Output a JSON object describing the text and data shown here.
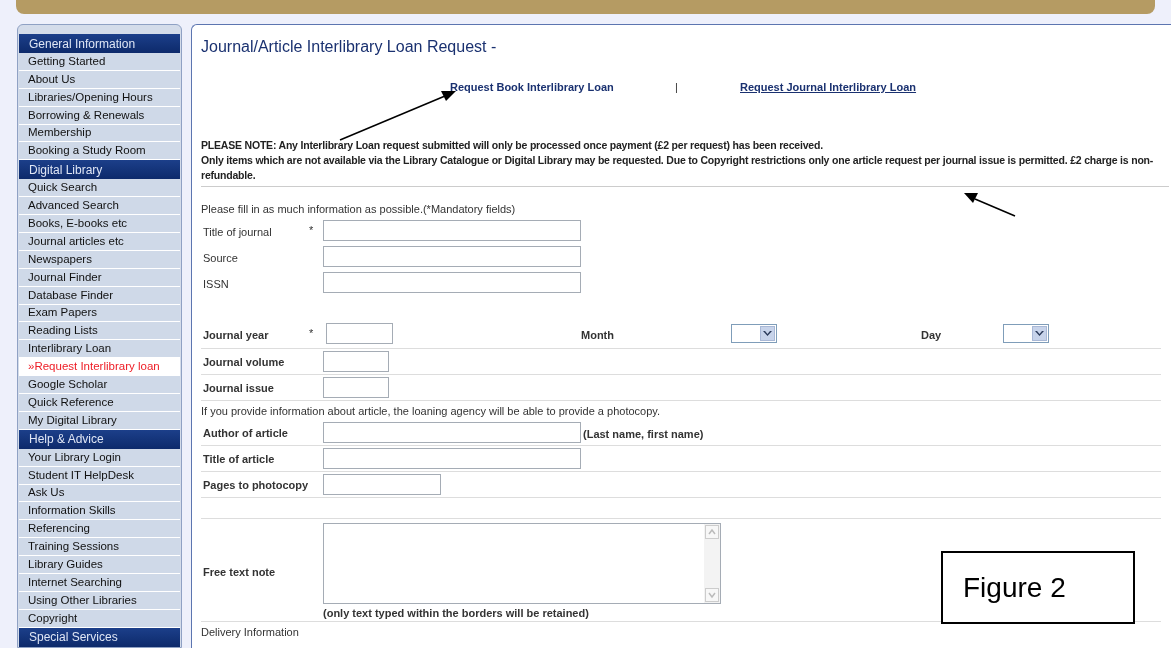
{
  "sidebar": {
    "sections": [
      {
        "heading": "General Information",
        "items": [
          {
            "label": "Getting Started",
            "selected": false
          },
          {
            "label": "About Us",
            "selected": false
          },
          {
            "label": "Libraries/Opening Hours",
            "selected": false
          },
          {
            "label": "Borrowing & Renewals",
            "selected": false
          },
          {
            "label": "Membership",
            "selected": false
          },
          {
            "label": "Booking a Study Room",
            "selected": false
          }
        ]
      },
      {
        "heading": "Digital Library",
        "items": [
          {
            "label": "Quick Search",
            "selected": false
          },
          {
            "label": "Advanced Search",
            "selected": false
          },
          {
            "label": "Books, E-books etc",
            "selected": false
          },
          {
            "label": "Journal articles etc",
            "selected": false
          },
          {
            "label": "Newspapers",
            "selected": false
          },
          {
            "label": "Journal Finder",
            "selected": false
          },
          {
            "label": "Database Finder",
            "selected": false
          },
          {
            "label": "Exam Papers",
            "selected": false
          },
          {
            "label": "Reading Lists",
            "selected": false
          },
          {
            "label": "Interlibrary Loan",
            "selected": false
          },
          {
            "label": "»Request Interlibrary loan",
            "selected": true
          },
          {
            "label": "Google Scholar",
            "selected": false
          },
          {
            "label": "Quick Reference",
            "selected": false
          },
          {
            "label": "My Digital Library",
            "selected": false
          }
        ]
      },
      {
        "heading": "Help & Advice",
        "items": [
          {
            "label": "Your Library Login",
            "selected": false
          },
          {
            "label": "Student IT HelpDesk",
            "selected": false
          },
          {
            "label": "Ask Us",
            "selected": false
          },
          {
            "label": "Information Skills",
            "selected": false
          },
          {
            "label": "Referencing",
            "selected": false
          },
          {
            "label": "Training Sessions",
            "selected": false
          },
          {
            "label": "Library Guides",
            "selected": false
          },
          {
            "label": "Internet Searching",
            "selected": false
          },
          {
            "label": "Using Other Libraries",
            "selected": false
          },
          {
            "label": "Copyright",
            "selected": false
          }
        ]
      },
      {
        "heading": "Special Services"
      }
    ]
  },
  "page": {
    "title": "Journal/Article Interlibrary Loan Request -",
    "links": [
      {
        "label": "Request Book Interlibrary Loan",
        "underlined": false
      },
      {
        "label": "Request Journal Interlibrary Loan",
        "underlined": true
      }
    ],
    "link_separator": "|",
    "notice": [
      "PLEASE NOTE: Any Interlibrary Loan request submitted will only be processed once payment (£2 per request) has been received.",
      "Only items which are not available via the Library Catalogue or Digital Library may be requested. Due to Copyright restrictions only one article request per journal issue is permitted. £2 charge is non-refundable."
    ]
  },
  "form": {
    "rows": [
      {
        "kind": "text",
        "text": "Please fill in as much information as possible.(*Mandatory fields)"
      },
      {
        "kind": "plain",
        "label": "Title of journal",
        "marker": "*"
      },
      {
        "kind": "plain",
        "label": "Source"
      },
      {
        "kind": "plain",
        "label": "ISSN"
      },
      {
        "kind": "spacer"
      },
      {
        "kind": "date",
        "label": "Journal year",
        "marker": "*",
        "month_label": "Month",
        "day_label": "Day"
      },
      {
        "kind": "short_field",
        "label": "Journal volume"
      },
      {
        "kind": "short_field",
        "label": "Journal issue"
      },
      {
        "kind": "text",
        "text": "If you provide information about article, the loaning agency will be able to provide a photocopy."
      },
      {
        "kind": "field",
        "label": "Author of article",
        "hint": "(Last name, first name)"
      },
      {
        "kind": "field",
        "label": "Title of article"
      },
      {
        "kind": "medium_field",
        "label": "Pages to photocopy"
      },
      {
        "kind": "spacer"
      },
      {
        "kind": "textarea",
        "label": "Free text note",
        "note": "(only text typed within the borders will be retained)"
      },
      {
        "kind": "text",
        "text": "Delivery Information"
      }
    ]
  },
  "figure_label": "Figure 2"
}
